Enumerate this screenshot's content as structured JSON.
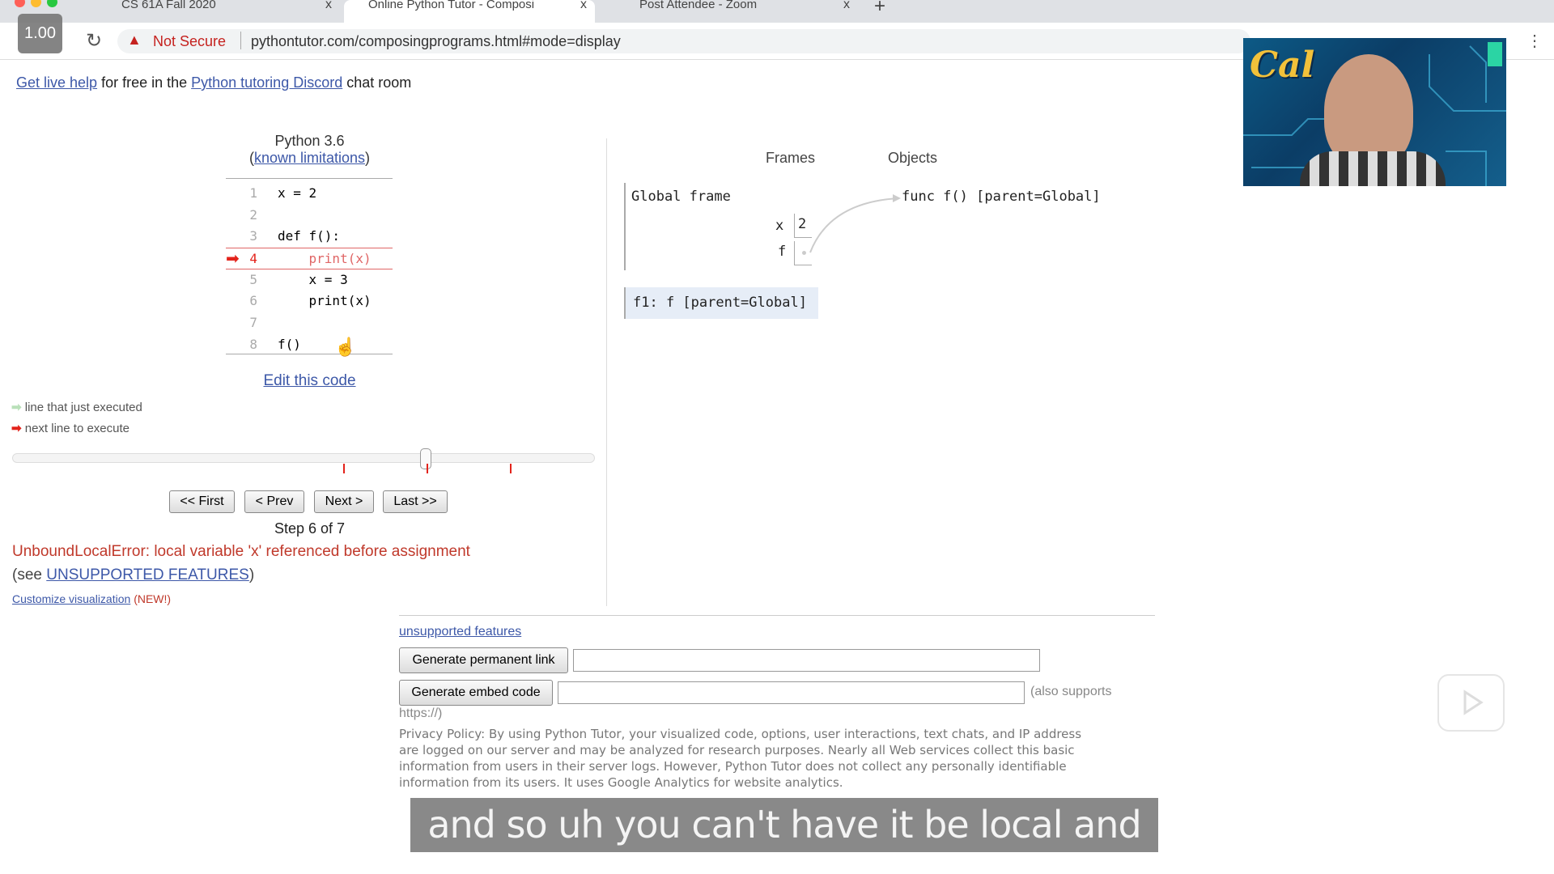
{
  "browser": {
    "tabs": [
      {
        "title": "CS 61A Fall 2020"
      },
      {
        "title": "Online Python Tutor - Composi"
      },
      {
        "title": "Post Attendee - Zoom"
      }
    ],
    "close_glyph": "x",
    "new_tab": "+",
    "security": "Not Secure",
    "url": "pythontutor.com/composingprograms.html#mode=display",
    "speed_badge": "1.00"
  },
  "banner": {
    "link1": "Get live help",
    "text1": " for free in the ",
    "link2": "Python tutoring Discord",
    "text2": " chat room"
  },
  "editor": {
    "language": "Python 3.6",
    "limitations_link": "known limitations",
    "lines": [
      {
        "n": "1",
        "code": "x = 2"
      },
      {
        "n": "2",
        "code": ""
      },
      {
        "n": "3",
        "code": "def f():"
      },
      {
        "n": "4",
        "code": "    print(x)"
      },
      {
        "n": "5",
        "code": "    x = 3"
      },
      {
        "n": "6",
        "code": "    print(x)"
      },
      {
        "n": "7",
        "code": ""
      },
      {
        "n": "8",
        "code": "f()"
      }
    ],
    "current_line": 4,
    "edit_link": "Edit this code",
    "legend_executed": "line that just executed",
    "legend_next": "next line to execute",
    "step_progress": 0.71,
    "buttons": {
      "first": "<< First",
      "prev": "< Prev",
      "next": "Next >",
      "last": "Last >>"
    },
    "step_text": "Step 6 of 7",
    "error": "UnboundLocalError: local variable 'x' referenced before assignment",
    "see_prefix": "(see ",
    "unsupported_link": "UNSUPPORTED FEATURES",
    "see_suffix": ")",
    "customize_link": "Customize visualization",
    "new_badge": "(NEW!)"
  },
  "viz": {
    "frames_header": "Frames",
    "objects_header": "Objects",
    "global_frame": "Global frame",
    "vars": [
      {
        "name": "x",
        "value": "2"
      },
      {
        "name": "f",
        "value": ""
      }
    ],
    "func_object": "func f() [parent=Global]",
    "f1_frame": "f1: f [parent=Global]"
  },
  "footer": {
    "unsupported": "unsupported features",
    "perm_link_btn": "Generate permanent link",
    "embed_btn": "Generate embed code",
    "also_supports": "(also supports",
    "https": "https://)",
    "privacy": [
      "Privacy Policy: By using Python Tutor, your visualized code, options, user interactions, text chats, and IP address",
      "are logged on our server and may be analyzed for research purposes. Nearly all Web services collect this basic",
      "information from users in their server logs. However, Python Tutor does not collect any personally identifiable",
      "information from its users. It uses Google Analytics for website analytics."
    ]
  },
  "caption": "and so uh you can't have it be local and",
  "colors": {
    "error": "#c0392b",
    "link": "#3d58a8",
    "arrow": "#e3231b"
  }
}
